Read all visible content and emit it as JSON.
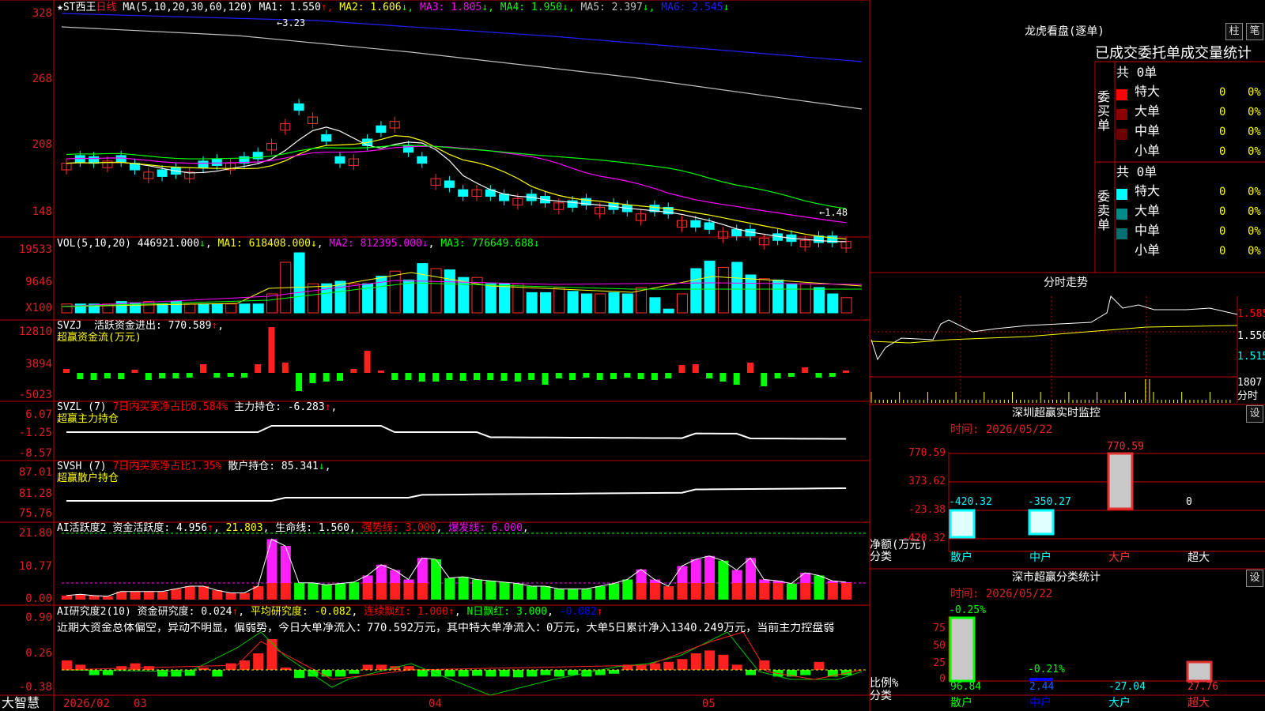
{
  "stock": {
    "name": "ST西王",
    "period": "日线",
    "ma_label": "MA(5,10,20,30,60,120)",
    "ma": [
      {
        "name": "MA1:",
        "val": "1.550",
        "arrow": "↑",
        "color": "#ffffff"
      },
      {
        "name": "MA2:",
        "val": "1.606",
        "arrow": "↓",
        "color": "#ffff00"
      },
      {
        "name": "MA3:",
        "val": "1.805",
        "arrow": "↓",
        "color": "#ff00ff"
      },
      {
        "name": "MA4:",
        "val": "1.950",
        "arrow": "↓",
        "color": "#00ff00"
      },
      {
        "name": "MA5:",
        "val": "2.397",
        "arrow": "↓",
        "color": "#c0c0c0"
      },
      {
        "name": "MA6:",
        "val": "2.545",
        "arrow": "↓",
        "color": "#2020ff"
      }
    ],
    "high_mark": "3.23",
    "low_mark": "1.48"
  },
  "yaxis": {
    "price": [
      "328",
      "268",
      "208",
      "148"
    ],
    "vol": [
      "19533",
      "9646",
      "X100"
    ],
    "svzj": [
      "12810",
      "3894",
      "-5023"
    ],
    "svzl": [
      "6.07",
      "-1.25",
      "-8.57"
    ],
    "svsh": [
      "87.01",
      "81.28",
      "75.76"
    ],
    "ai1": [
      "21.80",
      "10.77",
      "0.00"
    ],
    "ai2": [
      "0.90",
      "0.26",
      "-0.38"
    ]
  },
  "vol": {
    "label": "VOL(5,10,20)",
    "value": "446921.000",
    "arrow": "↓",
    "ma1": "618408.000",
    "ma2": "812395.000",
    "ma3": "776649.688"
  },
  "svzj": {
    "label": "SVZJ",
    "title": "活跃资金进出:",
    "value": "770.589",
    "arrow": "↑",
    "subtitle": "超赢资金流(万元)"
  },
  "svzl": {
    "label": "SVZL (7)",
    "ratio": "7日内买卖净占比0.584%",
    "hold_title": "主力持仓:",
    "hold": "-6.283",
    "arrow": "↑",
    "subtitle": "超赢主力持仓"
  },
  "svsh": {
    "label": "SVSH (7)",
    "ratio": "7日内买卖净占比1.35%",
    "hold_title": "散户持仓:",
    "hold": "85.341",
    "arrow": "↓",
    "subtitle": "超赢散户持仓"
  },
  "ai1": {
    "label": "AI活跃度2",
    "t1": "资金活跃度:",
    "v1": "4.956",
    "a1": "↑",
    "v2": "21.803",
    "t3": "生命线:",
    "v3": "1.560",
    "t4": "强势线:",
    "v4": "3.000",
    "t5": "爆发线:",
    "v5": "6.000"
  },
  "ai2": {
    "label": "AI研究度2(10)",
    "t1": "资金研究度:",
    "v1": "0.024",
    "a1": "↑",
    "t2": "平均研究度:",
    "v2": "-0.082",
    "t3": "连续飘红:",
    "v3": "1.000",
    "t4": "N日飘红:",
    "v4": "3.000",
    "v5": "-0.082",
    "comment": "近期大资金总体偏空，异动不明显，偏弱势，今日大单净流入：770.592万元，其中特大单净流入：0万元，大单5日累计净入1340.249万元，当前主力控盘弱"
  },
  "xaxis": {
    "brand": "大智慧",
    "labels": [
      "2026/02",
      "03",
      "04",
      "05"
    ]
  },
  "lhb": {
    "title": "龙虎看盘(逐单)",
    "btn1": "柱",
    "btn2": "笔",
    "subtitle": "已成交委托单成交量统计",
    "buy": {
      "side": "委买单",
      "total": "共 0单",
      "rows": [
        {
          "name": "特大",
          "v": "0",
          "p": "0%",
          "c": "#ff0000"
        },
        {
          "name": "大单",
          "v": "0",
          "p": "0%",
          "c": "#8b0000"
        },
        {
          "name": "中单",
          "v": "0",
          "p": "0%",
          "c": "#6b0000"
        },
        {
          "name": "小单",
          "v": "0",
          "p": "0%",
          "c": "#000000"
        }
      ]
    },
    "sell": {
      "side": "委卖单",
      "total": "共 0单",
      "rows": [
        {
          "name": "特大",
          "v": "0",
          "p": "0%",
          "c": "#00ffff"
        },
        {
          "name": "大单",
          "v": "0",
          "p": "0%",
          "c": "#008b8b"
        },
        {
          "name": "中单",
          "v": "0",
          "p": "0%",
          "c": "#007070"
        },
        {
          "name": "小单",
          "v": "0",
          "p": "0%",
          "c": "#000000"
        }
      ]
    }
  },
  "fenshi": {
    "title": "分时走势",
    "y": [
      "1.585",
      "1.550",
      "1.515"
    ],
    "vol_label": "1807",
    "time_label": "分时"
  },
  "sz_monitor": {
    "title": "深圳超赢实时监控",
    "btn": "设",
    "date": "时间: 2026/05/22",
    "y": [
      "770.59",
      "373.62",
      "-23.38",
      "-420.32"
    ],
    "unit": "净额(万元)",
    "fen": "分类",
    "cats": [
      "散户",
      "中户",
      "大户",
      "超大"
    ],
    "values": [
      "-420.32",
      "-350.27",
      "770.59",
      "0"
    ]
  },
  "sz_class": {
    "title": "深市超赢分类统计",
    "btn": "设",
    "date": "时间: 2026/05/22",
    "y": [
      "75",
      "50",
      "25",
      "0"
    ],
    "unit": "比例%",
    "fen": "分类",
    "cats": [
      "散户",
      "中户",
      "大户",
      "超大"
    ],
    "top": [
      "-0.25%",
      "-0.21%",
      "",
      ""
    ],
    "bottom": [
      "96.84",
      "2.44",
      "-27.04",
      "27.76"
    ]
  }
}
